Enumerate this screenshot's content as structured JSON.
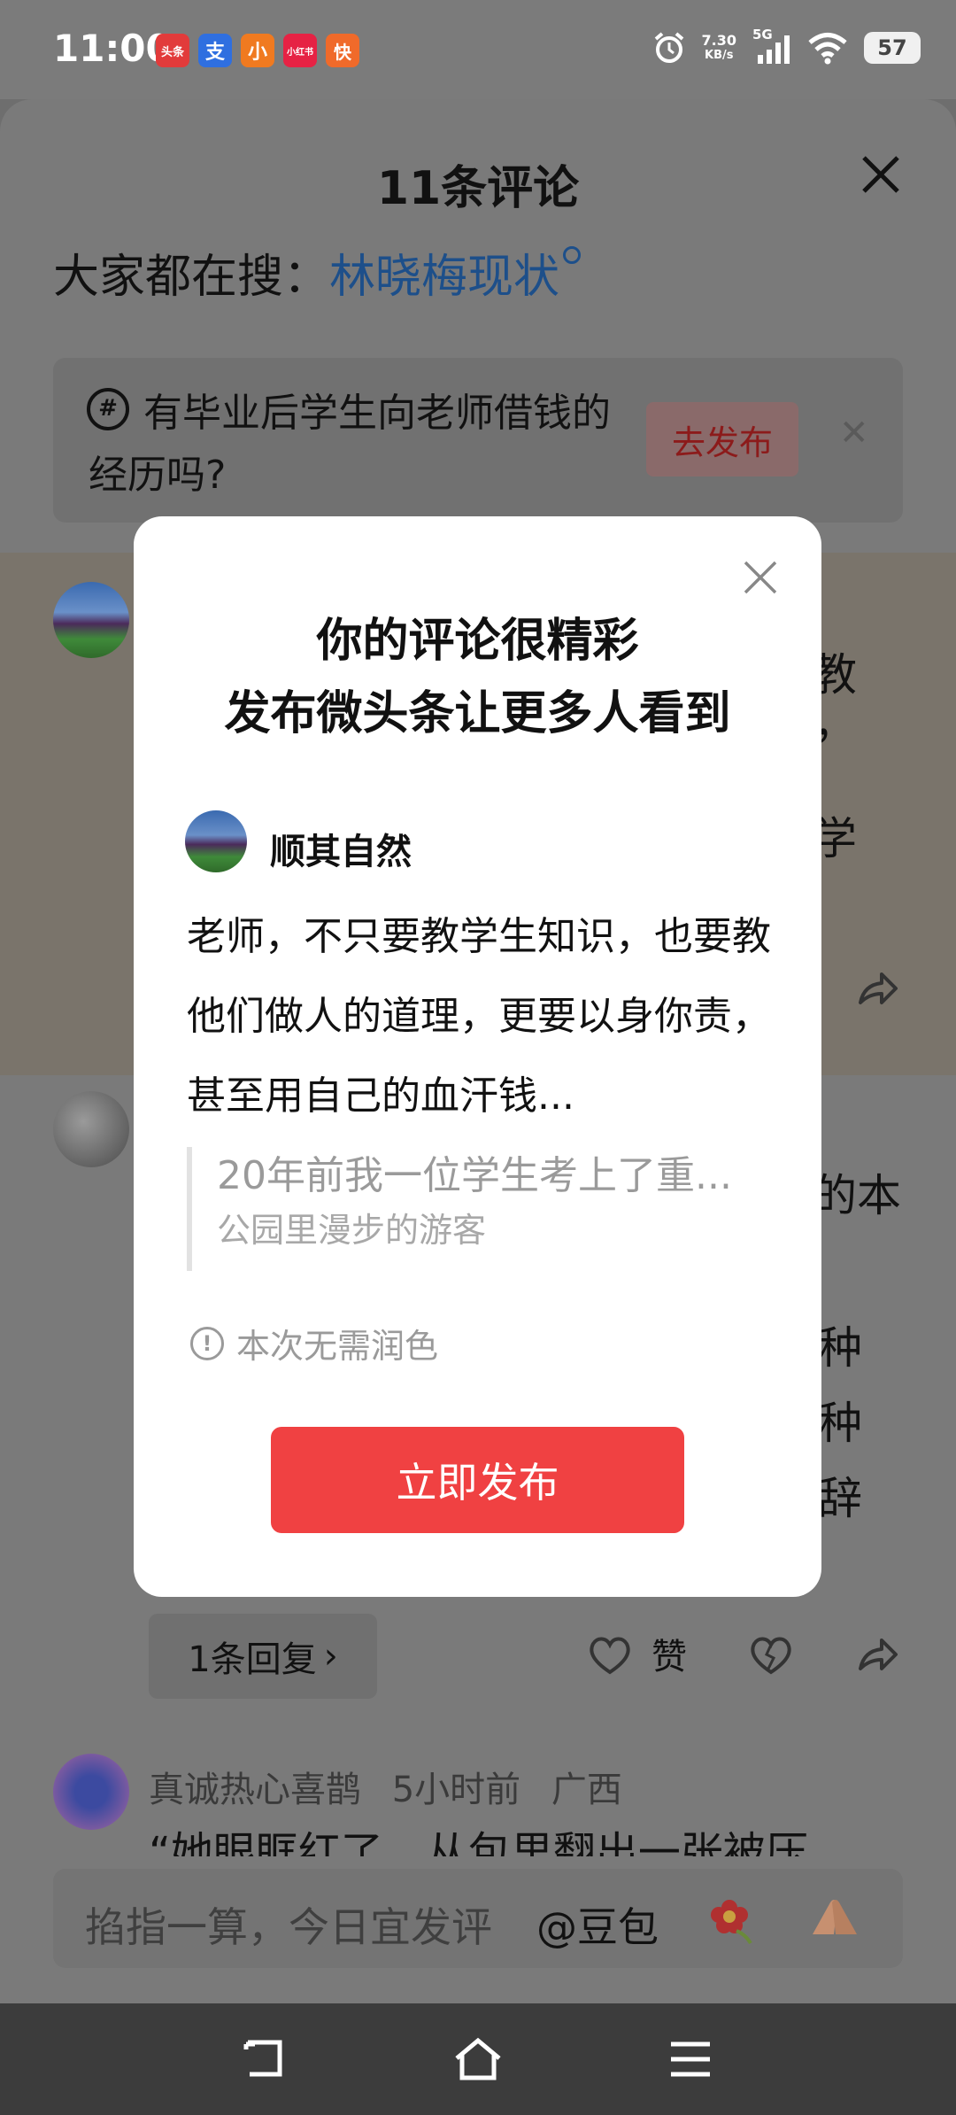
{
  "status_bar": {
    "time": "11:00",
    "notification_apps": [
      "头条",
      "支",
      "小",
      "小红书",
      "快"
    ],
    "net_speed_value": "7.30",
    "net_speed_unit": "KB/s",
    "network": "5G",
    "battery": "57"
  },
  "sheet": {
    "title": "11条评论",
    "search_prefix": "大家都在搜：",
    "search_term": "林晓梅现状",
    "topic": {
      "text": "有毕业后学生向老师借钱的经历吗?",
      "button": "去发布"
    },
    "bg_fragments": [
      "教",
      "，",
      "学",
      "的本",
      "种",
      "种",
      "辞"
    ],
    "reply_count": "1条回复",
    "like_label": "赞",
    "third_comment": {
      "author": "真诚热心喜鹊",
      "time": "5小时前",
      "location": "广西",
      "text": "“她眼眶红了，从包里翻出一张被压"
    },
    "input_placeholder": "掐指一算，今日宜发评",
    "input_mention": "@豆包"
  },
  "modal": {
    "title_line1": "你的评论很精彩",
    "title_line2": "发布微头条让更多人看到",
    "author": "顺其自然",
    "comment": "老师，不只要教学生知识，也要教他们做人的道理，更要以身你责，甚至用自己的血汗钱...",
    "quote_text": "20年前我一位学生考上了重...",
    "quote_source": "公园里漫步的游客",
    "polish_note": "本次无需润色",
    "publish_button": "立即发布"
  },
  "colors": {
    "accent_red": "#f04142",
    "link_blue": "#1d4f8a"
  }
}
